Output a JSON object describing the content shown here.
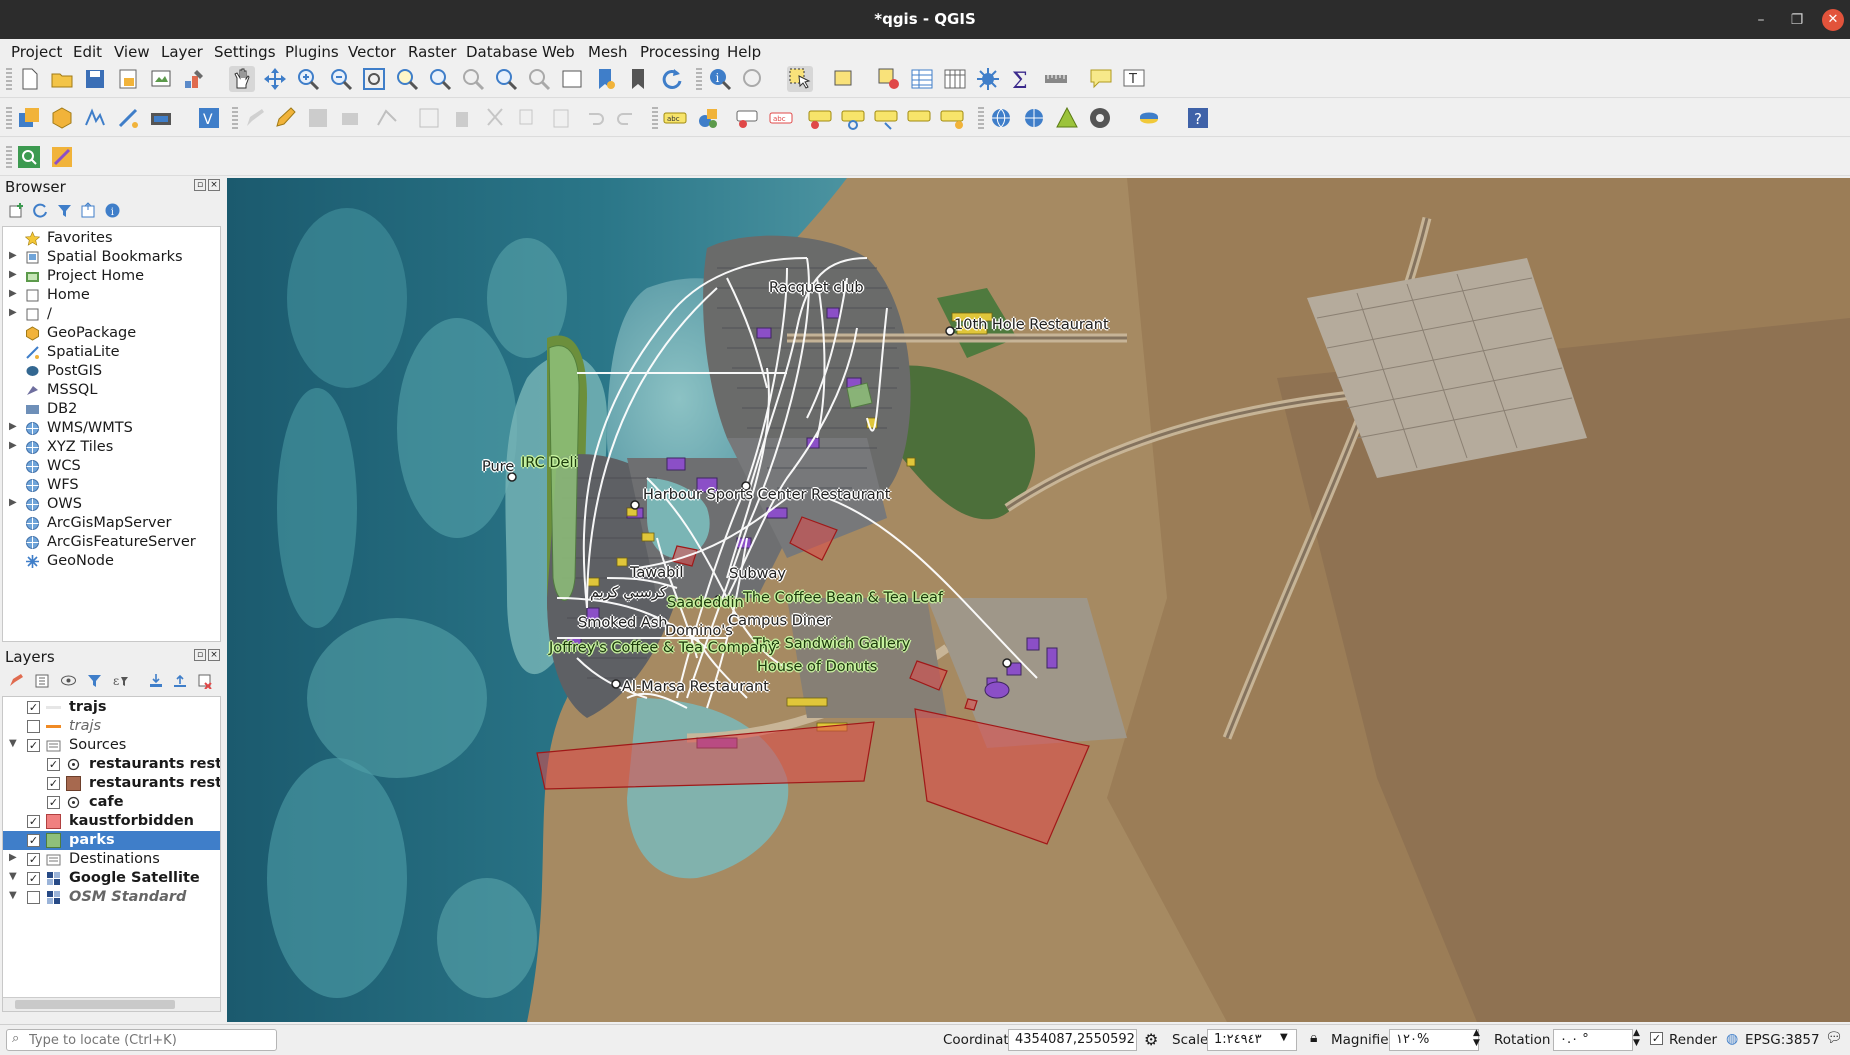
{
  "window": {
    "title": "*qgis - QGIS",
    "minimize": "–",
    "maximize": "❐",
    "close": "✕"
  },
  "menu": [
    "Project",
    "Edit",
    "View",
    "Layer",
    "Settings",
    "Plugins",
    "Vector",
    "Raster",
    "Database",
    "Web",
    "Mesh",
    "Processing",
    "Help"
  ],
  "browser": {
    "title": "Browser",
    "items": [
      {
        "label": "Favorites",
        "icon": "star-icon"
      },
      {
        "label": "Spatial Bookmarks",
        "icon": "bookmark-icon"
      },
      {
        "label": "Project Home",
        "icon": "project-home-icon"
      },
      {
        "label": "Home",
        "icon": "home-folder-icon"
      },
      {
        "label": "/",
        "icon": "folder-icon"
      },
      {
        "label": "GeoPackage",
        "icon": "geopackage-icon"
      },
      {
        "label": "SpatiaLite",
        "icon": "spatialite-icon"
      },
      {
        "label": "PostGIS",
        "icon": "postgis-icon"
      },
      {
        "label": "MSSQL",
        "icon": "mssql-icon"
      },
      {
        "label": "DB2",
        "icon": "db2-icon"
      },
      {
        "label": "WMS/WMTS",
        "icon": "globe-icon"
      },
      {
        "label": "XYZ Tiles",
        "icon": "globe-icon"
      },
      {
        "label": "WCS",
        "icon": "globe-icon"
      },
      {
        "label": "WFS",
        "icon": "globe-icon"
      },
      {
        "label": "OWS",
        "icon": "globe-icon"
      },
      {
        "label": "ArcGisMapServer",
        "icon": "globe-icon"
      },
      {
        "label": "ArcGisFeatureServer",
        "icon": "globe-icon"
      },
      {
        "label": "GeoNode",
        "icon": "geonode-icon"
      }
    ]
  },
  "layers": {
    "title": "Layers",
    "items": [
      {
        "label": "trajs",
        "checked": "✓",
        "style": "bold",
        "color": "#e8e8e8"
      },
      {
        "label": "trajs",
        "checked": "",
        "style": "italic",
        "color": "#f08a24"
      },
      {
        "label": "Sources",
        "checked": "✓",
        "style": "normal",
        "color": ""
      },
      {
        "label": "restaurants restau",
        "checked": "✓",
        "style": "bold",
        "color": ""
      },
      {
        "label": "restaurants restau",
        "checked": "✓",
        "style": "bold",
        "color": "#a7694f"
      },
      {
        "label": "cafe",
        "checked": "✓",
        "style": "bold",
        "color": ""
      },
      {
        "label": "kaustforbidden",
        "checked": "✓",
        "style": "bold",
        "color": "#f08080"
      },
      {
        "label": "parks",
        "checked": "✓",
        "style": "bold",
        "color": "#8fc07a"
      },
      {
        "label": "Destinations",
        "checked": "✓",
        "style": "normal",
        "color": ""
      },
      {
        "label": "Google Satellite",
        "checked": "✓",
        "style": "bold",
        "color": ""
      },
      {
        "label": "OSM Standard",
        "checked": "",
        "style": "italic",
        "color": ""
      }
    ]
  },
  "map_labels": [
    {
      "text": "Racquet club",
      "color": "white"
    },
    {
      "text": "10th Hole Restaurant",
      "color": "white"
    },
    {
      "text": "Pure",
      "color": "white"
    },
    {
      "text": "IRC Deli",
      "color": "green"
    },
    {
      "text": "Harbour Sports Center Restaurant",
      "color": "white"
    },
    {
      "text": "Tawabil",
      "color": "white"
    },
    {
      "text": "Subway",
      "color": "white"
    },
    {
      "text": "The Coffee Bean & Tea Leaf",
      "color": "green"
    },
    {
      "text": "كرسبي كريم",
      "color": "white"
    },
    {
      "text": "Saadeddin",
      "color": "green"
    },
    {
      "text": "Smoked Ash",
      "color": "white"
    },
    {
      "text": "Campus Diner",
      "color": "white"
    },
    {
      "text": "Domino's",
      "color": "white"
    },
    {
      "text": "The Sandwich Gallery",
      "color": "green"
    },
    {
      "text": "Joffrey's Coffee & Tea Company",
      "color": "green"
    },
    {
      "text": "House of Donuts",
      "color": "green"
    },
    {
      "text": "Al-Marsa Restaurant",
      "color": "white"
    }
  ],
  "status": {
    "locate_placeholder": "Type to locate (Ctrl+K)",
    "coordinate_label": "Coordinate",
    "coordinate_value": "4354087,2550592",
    "scale_label": "Scale",
    "scale_value": "1:٢٤٩٤٣",
    "magnifier_label": "Magnifier",
    "magnifier_value": "١٢٠%",
    "rotation_label": "Rotation",
    "rotation_value": "٠.٠ °",
    "render_label": "Render",
    "crs": "EPSG:3857"
  },
  "colors": {
    "label_white": "#ffffff",
    "label_green": "#c8f3a0",
    "forbidden_fill": "#e04848",
    "building_purple": "#8b4fc7",
    "selection_blue": "#3f7ec9"
  }
}
